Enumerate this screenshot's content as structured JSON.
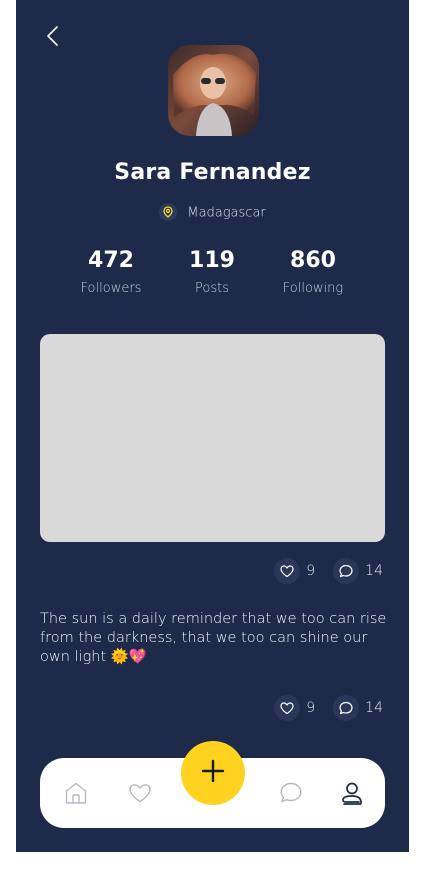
{
  "profile": {
    "name": "Sara Fernandez",
    "location": "Madagascar"
  },
  "stats": [
    {
      "value": "472",
      "label": "Followers"
    },
    {
      "value": "119",
      "label": "Posts"
    },
    {
      "value": "860",
      "label": "Following"
    }
  ],
  "posts": [
    {
      "likes": "9",
      "comments": "14"
    },
    {
      "caption": "The sun is a daily reminder that we too can rise from the darkness, that we too can shine our own light 🌞💖",
      "likes": "9",
      "comments": "14"
    }
  ],
  "nav": {
    "items": [
      "home-icon",
      "heart-icon",
      "add-icon",
      "chat-icon",
      "profile-icon"
    ],
    "active": "profile-icon"
  },
  "colors": {
    "background": "#1e2a4a",
    "accent": "#ffd21f",
    "image_placeholder": "#d9d9d9",
    "nav_bar": "#ffffff"
  }
}
